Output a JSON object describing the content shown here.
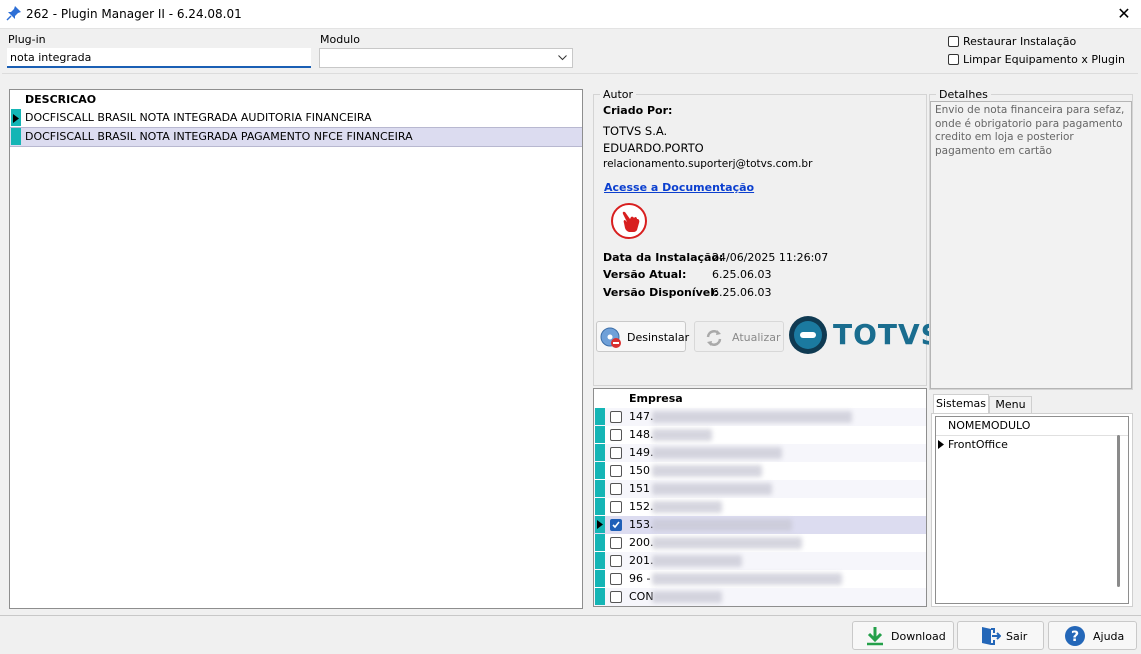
{
  "window": {
    "title": "262 - Plugin Manager II - 6.24.08.01",
    "close_glyph": "✕"
  },
  "filters": {
    "plugin_label": "Plug-in",
    "plugin_value": "nota integrada",
    "modulo_label": "Modulo",
    "modulo_value": "",
    "restaurar_label": "Restaurar Instalação",
    "limpar_label": "Limpar Equipamento x Plugin"
  },
  "plugins_grid": {
    "header": "DESCRICAO",
    "rows": [
      "DOCFISCALL BRASIL NOTA INTEGRADA AUDITORIA FINANCEIRA",
      "DOCFISCALL BRASIL NOTA INTEGRADA PAGAMENTO NFCE FINANCEIRA"
    ]
  },
  "autor": {
    "group_title": "Autor",
    "criado_por_label": "Criado Por:",
    "company": "TOTVS S.A.",
    "person": "EDUARDO.PORTO",
    "email": "relacionamento.suporterj@totvs.com.br",
    "doc_link": "Acesse a Documentação",
    "data_instalacao_label": "Data da Instalação:",
    "data_instalacao_value": "24/06/2025 11:26:07",
    "versao_atual_label": "Versão Atual:",
    "versao_atual_value": "6.25.06.03",
    "versao_disponivel_label": "Versão Disponível:",
    "versao_disponivel_value": "6.25.06.03",
    "desinstalar_label": "Desinstalar",
    "atualizar_label": "Atualizar",
    "logo_text": "TOTVS"
  },
  "detalhes": {
    "group_title": "Detalhes",
    "text": "Envio de nota financeira para sefaz, onde é obrigatorio para pagamento credito em loja e posterior pagamento em cartão"
  },
  "empresas": {
    "header": "Empresa",
    "rows": [
      {
        "code": "147.",
        "checked": false
      },
      {
        "code": "148.",
        "checked": false
      },
      {
        "code": "149.",
        "checked": false
      },
      {
        "code": "150",
        "checked": false
      },
      {
        "code": "151",
        "checked": false
      },
      {
        "code": "152.",
        "checked": false
      },
      {
        "code": "153.",
        "checked": true
      },
      {
        "code": "200.",
        "checked": false
      },
      {
        "code": "201.",
        "checked": false
      },
      {
        "code": "96 -",
        "checked": false
      },
      {
        "code": "CON",
        "checked": false
      }
    ]
  },
  "sistemas": {
    "tabs": [
      "Sistemas",
      "Menu"
    ],
    "header": "NOMEMODULO",
    "rows": [
      "FrontOffice"
    ]
  },
  "footer": {
    "download_label": "Download",
    "sair_label": "Sair",
    "ajuda_label": "Ajuda"
  },
  "colors": {
    "accent_teal": "#14b5b5",
    "link_blue": "#0b3fcf",
    "totvs_blue": "#1a6d8f",
    "selected_row": "#dcdcf0"
  }
}
